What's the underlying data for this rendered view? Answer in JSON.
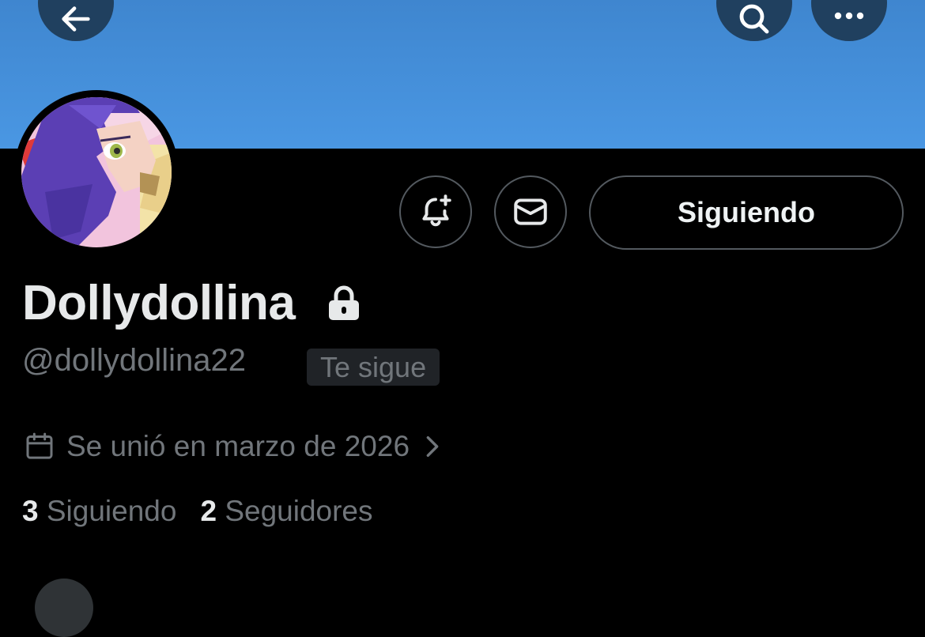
{
  "profile": {
    "display_name": "Dollydollina",
    "handle": "@dollydollina22",
    "follows_you_badge": "Te sigue",
    "joined_text": "Se unió en marzo de 2026",
    "following_count": "3",
    "following_label": "Siguiendo",
    "followers_count": "2",
    "followers_label": "Seguidores"
  },
  "actions": {
    "follow_state_label": "Siguiendo"
  },
  "icons": {
    "back": "arrow-left-icon",
    "search": "search-icon",
    "more": "more-horizontal-icon",
    "notify": "bell-plus-icon",
    "message": "envelope-icon",
    "protected": "lock-icon",
    "joined": "calendar-icon",
    "joined_chevron": "chevron-right-icon"
  },
  "colors": {
    "banner": "#4a97e3",
    "background": "#000000",
    "primary_text": "#e7e9ea",
    "secondary_text": "#71767b",
    "nav_button_bg": "#20405f",
    "button_border": "#53595f"
  }
}
